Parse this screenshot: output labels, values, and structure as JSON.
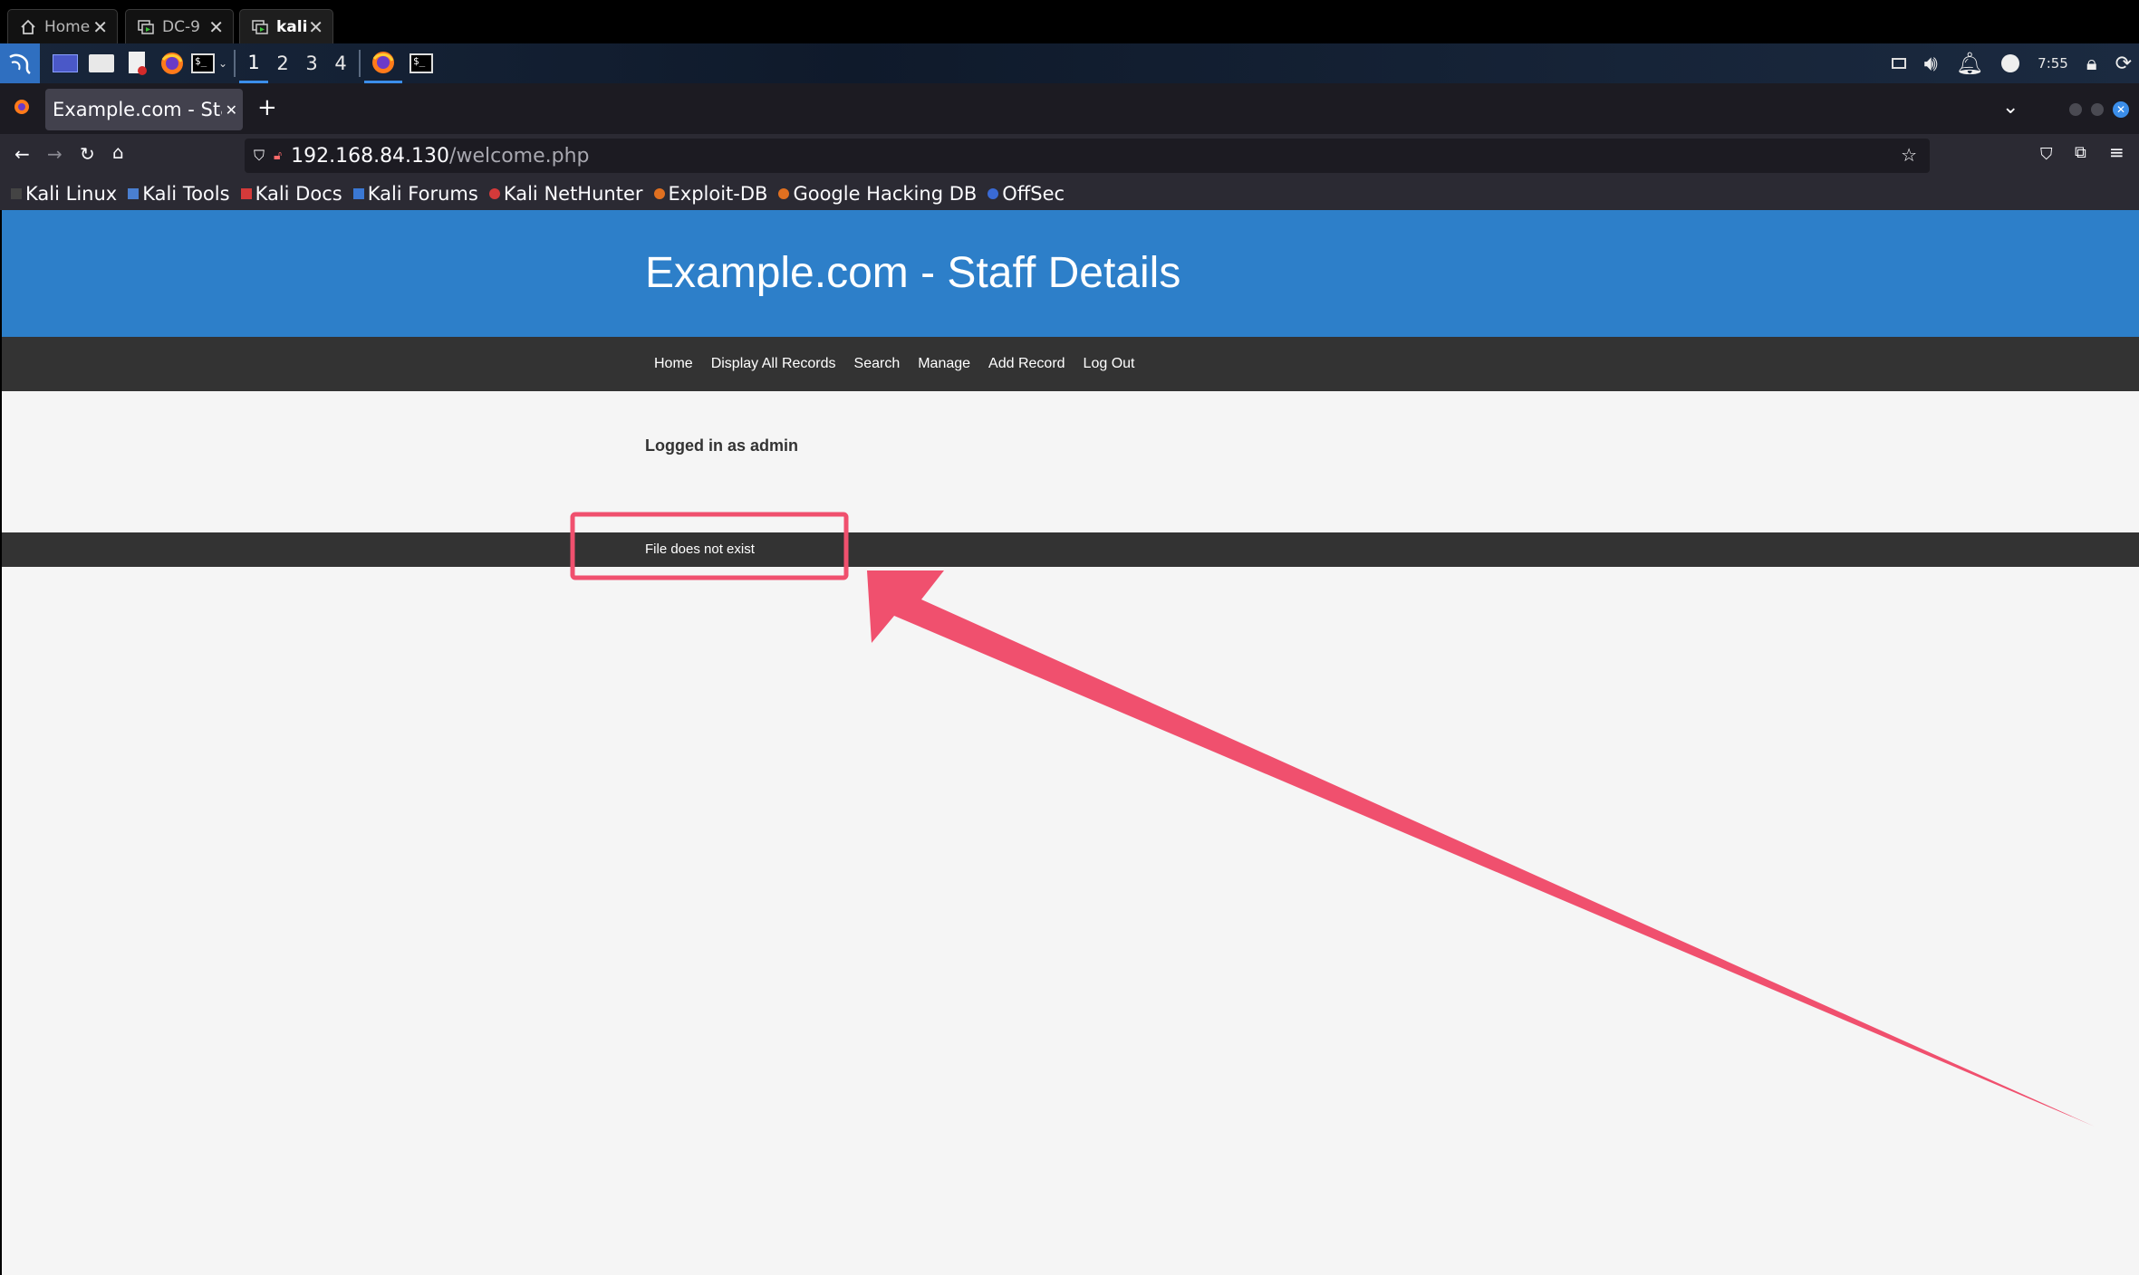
{
  "vm_tabs": [
    {
      "label": "Home",
      "icon": "home-icon"
    },
    {
      "label": "DC-9",
      "icon": "vm-icon"
    },
    {
      "label": "kali",
      "icon": "vm-icon",
      "active": true
    }
  ],
  "panel": {
    "workspaces": [
      "1",
      "2",
      "3",
      "4"
    ],
    "active_workspace": "1",
    "clock": "7:55"
  },
  "browser": {
    "tab_title": "Example.com - Sta",
    "new_tab": "+",
    "url_host": "192.168.84.130",
    "url_path": "/welcome.php",
    "bookmarks": [
      {
        "label": "Kali Linux",
        "color": "#444444"
      },
      {
        "label": "Kali Tools",
        "color": "#4a7fd0"
      },
      {
        "label": "Kali Docs",
        "color": "#d43a3a"
      },
      {
        "label": "Kali Forums",
        "color": "#3a78d4"
      },
      {
        "label": "Kali NetHunter",
        "color": "#d43a3a"
      },
      {
        "label": "Exploit-DB",
        "color": "#e07020"
      },
      {
        "label": "Google Hacking DB",
        "color": "#e07020"
      },
      {
        "label": "OffSec",
        "color": "#3a6ad4"
      }
    ]
  },
  "page": {
    "header_title": "Example.com - Staff Details",
    "nav": [
      "Home",
      "Display All Records",
      "Search",
      "Manage",
      "Add Record",
      "Log Out"
    ],
    "logged_in": "Logged in as admin",
    "message": "File does not exist"
  },
  "colors": {
    "header_blue": "#2d7fc9",
    "nav_dark": "#333333",
    "annotation_red": "#f0506e"
  }
}
